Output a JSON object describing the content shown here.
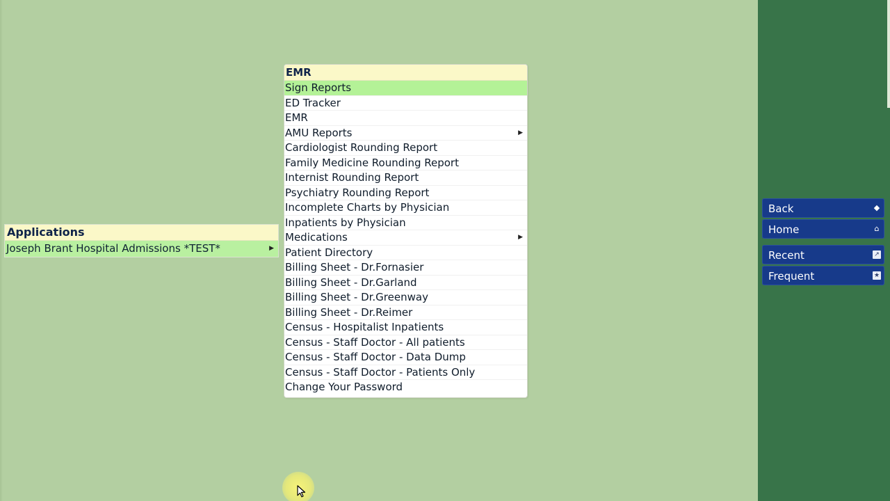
{
  "applications_menu": {
    "header": "Applications",
    "items": [
      {
        "label": "Joseph Brant Hospital Admissions *TEST*",
        "has_submenu": true
      }
    ]
  },
  "emr_menu": {
    "header": "EMR",
    "items": [
      {
        "label": "Sign Reports"
      },
      {
        "label": "ED Tracker"
      },
      {
        "label": "EMR"
      },
      {
        "label": "AMU Reports",
        "has_submenu": true
      },
      {
        "label": "Cardiologist Rounding Report"
      },
      {
        "label": "Family Medicine Rounding Report"
      },
      {
        "label": "Internist Rounding Report"
      },
      {
        "label": "Psychiatry Rounding Report"
      },
      {
        "label": "Incomplete Charts by Physician"
      },
      {
        "label": "Inpatients by Physician"
      },
      {
        "label": "Medications",
        "has_submenu": true
      },
      {
        "label": "Patient Directory"
      },
      {
        "label": "Billing Sheet - Dr.Fornasier"
      },
      {
        "label": "Billing Sheet - Dr.Garland"
      },
      {
        "label": "Billing Sheet - Dr.Greenway"
      },
      {
        "label": "Billing Sheet - Dr.Reimer"
      },
      {
        "label": "Census - Hospitalist Inpatients"
      },
      {
        "label": "Census - Staff Doctor - All patients"
      },
      {
        "label": "Census - Staff Doctor - Data Dump"
      },
      {
        "label": "Census - Staff Doctor - Patients Only"
      },
      {
        "label": "Change Your Password"
      }
    ]
  },
  "nav": {
    "back_label": "Back",
    "home_label": "Home",
    "recent_label": "Recent",
    "frequent_label": "Frequent"
  },
  "colors": {
    "background": "#b3cfa1",
    "right_panel": "#387449",
    "menu_header": "#fbf8c8",
    "highlight": "#b4f297",
    "nav_button": "#173a8a"
  },
  "icons": {
    "submenu": "chevron-right-icon",
    "back": "back-arrow-icon",
    "home": "home-icon",
    "recent": "recent-icon",
    "frequent": "frequent-icon"
  }
}
